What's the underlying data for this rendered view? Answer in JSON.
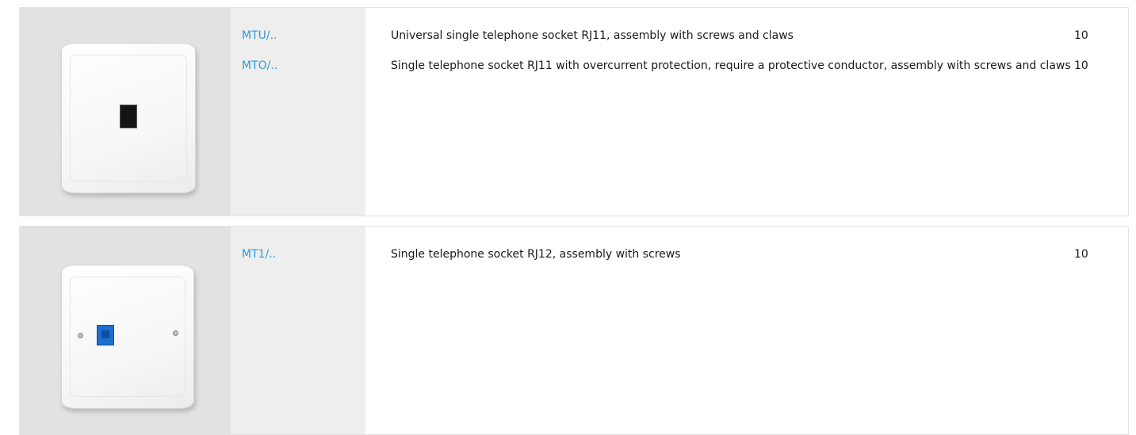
{
  "rows": [
    {
      "image_alt": "White single telephone socket with black RJ11 port",
      "items": [
        {
          "code": "MTU/..",
          "description": "Universal single telephone socket RJ11, assembly with screws and claws",
          "qty": "10"
        },
        {
          "code": "MTO/..",
          "description": "Single telephone socket RJ11 with overcurrent protection, require a protective conductor, assembly with screws and claws",
          "qty": "10"
        }
      ]
    },
    {
      "image_alt": "White single telephone socket with blue RJ12 port and two screws",
      "items": [
        {
          "code": "MT1/..",
          "description": "Single telephone socket RJ12, assembly with screws",
          "qty": "10"
        }
      ]
    }
  ],
  "colors": {
    "code_text": "#2e9cd6",
    "image_bg": "#e2e2e2",
    "code_bg": "#eeeeee",
    "port_black": "#141414",
    "port_blue": "#1f6fd0"
  }
}
